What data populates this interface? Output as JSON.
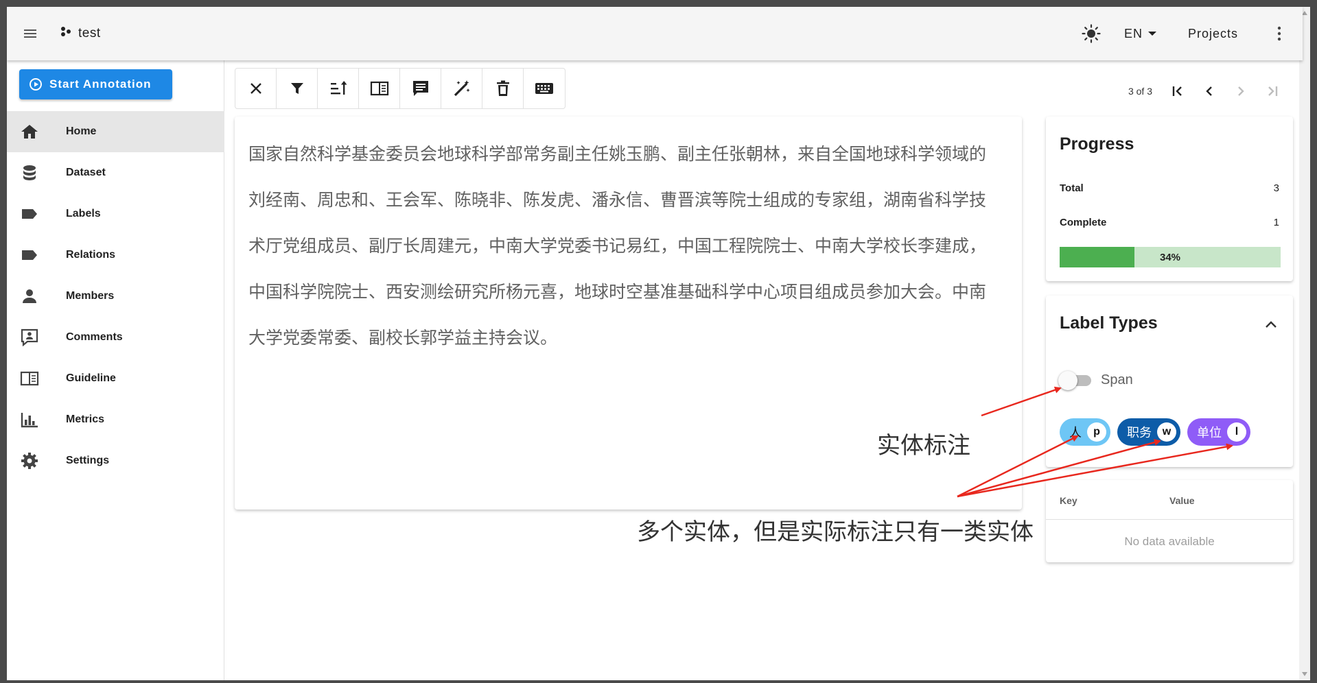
{
  "app": {
    "title": "test"
  },
  "header": {
    "language": "EN",
    "projects_label": "Projects"
  },
  "sidebar": {
    "start_label": "Start Annotation",
    "items": [
      {
        "label": "Home",
        "icon": "home-icon",
        "active": true
      },
      {
        "label": "Dataset",
        "icon": "database-icon"
      },
      {
        "label": "Labels",
        "icon": "label-icon"
      },
      {
        "label": "Relations",
        "icon": "label-icon"
      },
      {
        "label": "Members",
        "icon": "account-icon"
      },
      {
        "label": "Comments",
        "icon": "comment-account-icon"
      },
      {
        "label": "Guideline",
        "icon": "book-open-icon"
      },
      {
        "label": "Metrics",
        "icon": "chart-bar-icon"
      },
      {
        "label": "Settings",
        "icon": "cog-icon"
      }
    ]
  },
  "toolbar": {
    "buttons": [
      "close-icon",
      "filter-icon",
      "sort-icon",
      "book-open-icon",
      "comment-icon",
      "auto-fix-icon",
      "delete-icon",
      "keyboard-icon"
    ]
  },
  "pager": {
    "count": "3 of 3"
  },
  "document": {
    "text": "国家自然科学基金委员会地球科学部常务副主任姚玉鹏、副主任张朝林，来自全国地球科学领域的刘经南、周忠和、王会军、陈晓非、陈发虎、潘永信、曹晋滨等院士组成的专家组，湖南省科学技术厅党组成员、副厅长周建元，中南大学党委书记易红，中国工程院院士、中南大学校长李建成，中国科学院院士、西安测绘研究所杨元喜，地球时空基准基础科学中心项目组成员参加大会。中南大学党委常委、副校长郭学益主持会议。"
  },
  "progress": {
    "title": "Progress",
    "total_label": "Total",
    "total": "3",
    "complete_label": "Complete",
    "complete": "1",
    "percent_value": 34,
    "percent_text": "34%"
  },
  "label_types": {
    "title": "Label Types",
    "toggle_label": "Span",
    "toggle_on": false,
    "chips": [
      {
        "label": "人",
        "key": "p",
        "color": "#6ec6f5",
        "text_color": "#111111"
      },
      {
        "label": "职务",
        "key": "w",
        "color": "#0d5ca8",
        "text_color": "#ffffff"
      },
      {
        "label": "单位",
        "key": "l",
        "color": "#8f5cf7",
        "text_color": "#ffffff"
      }
    ]
  },
  "metadata_table": {
    "key_header": "Key",
    "value_header": "Value",
    "empty_text": "No data available"
  },
  "annotations": {
    "note1": "实体标注",
    "note2": "多个实体，但是实际标注只有一类实体",
    "arrow_color": "#e8281e"
  },
  "colors": {
    "primary": "#1e88e5",
    "progress": "#4caf50",
    "progress_bg": "#c8e6c9"
  }
}
